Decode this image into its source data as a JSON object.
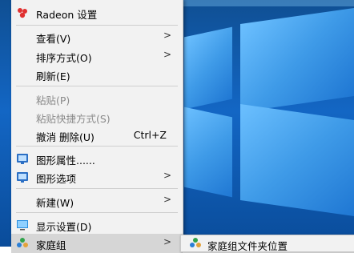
{
  "menu": {
    "radeon": "Radeon 设置",
    "view": "查看(V)",
    "sort": "排序方式(O)",
    "refresh": "刷新(E)",
    "paste": "粘贴(P)",
    "paste_shortcut": "粘贴快捷方式(S)",
    "undo": "撤消 删除(U)",
    "undo_shortcut": "Ctrl+Z",
    "graphics_props": "图形属性......",
    "graphics_options": "图形选项",
    "new": "新建(W)",
    "display": "显示设置(D)",
    "homegroup": "家庭组"
  },
  "submenu": {
    "location": "家庭组文件夹位置"
  },
  "colors": {
    "menu_bg": "#f2f2f2",
    "radeon_red": "#e03030",
    "desktop_blue": "#1366c4"
  }
}
